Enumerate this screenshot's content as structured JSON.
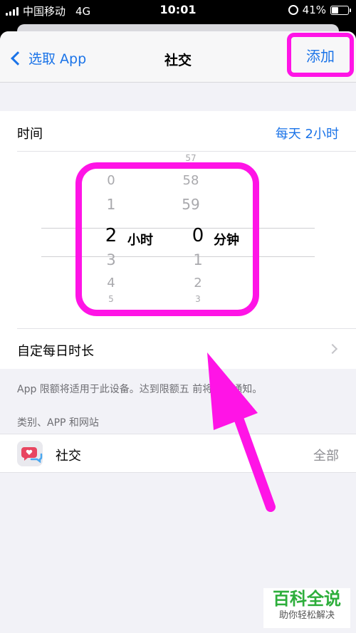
{
  "status_bar": {
    "carrier": "中国移动",
    "network": "4G",
    "time": "10:01",
    "battery": "41%"
  },
  "nav": {
    "back_label": "选取 App",
    "title": "社交",
    "add_label": "添加"
  },
  "time_limit": {
    "label": "时间",
    "value": "每天 2小时"
  },
  "picker": {
    "hours": [
      "0",
      "1",
      "2",
      "3",
      "4",
      "5"
    ],
    "hours_unit": "小时",
    "minutes": [
      "57",
      "58",
      "59",
      "0",
      "1",
      "2",
      "3"
    ],
    "minutes_unit": "分钟",
    "selected_hours": "2",
    "selected_minutes": "0"
  },
  "custom_daily": {
    "label": "自定每日时长"
  },
  "note": "App 限额将适用于此设备。达到限额五 前将显示通知。",
  "category_header": "类别、APP 和网站",
  "app_row": {
    "name": "社交",
    "value": "全部",
    "icon": "social-chat-heart-icon"
  },
  "watermark": {
    "main": "百科全说",
    "sub": "助你轻松解决"
  },
  "colors": {
    "accent": "#1a73e8",
    "highlight": "#ff14e6",
    "watermark": "#2dae3b"
  }
}
